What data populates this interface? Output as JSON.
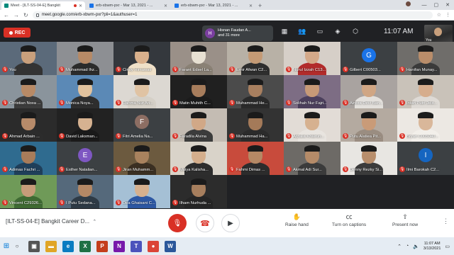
{
  "browser": {
    "tabs": [
      {
        "label": "Meet - [ILT-SS-04-E] Bangkit",
        "active": true,
        "recording": true
      },
      {
        "label": "erb-xbwm-pxr - Mar 13, 2021 - ...",
        "active": false,
        "recording": false
      },
      {
        "label": "erb-xbwm-pxr - Mar 13, 2021 - ...",
        "active": false,
        "recording": false
      }
    ],
    "url": "meet.google.com/erb-xbwm-pxr?pli=1&authuser=1"
  },
  "meet": {
    "recording_label": "REC",
    "presenter_initial": "H",
    "presenter_line1": "Hisnan Faudan A...",
    "presenter_line2": "and 31 more",
    "time": "11:07 AM",
    "self_label": "You",
    "meeting_name": "[ILT-SS-04-E] Bangkit Career D...",
    "controls": {
      "raise_hand": "Raise hand",
      "captions": "Turn on captions",
      "present": "Present now"
    },
    "participants": [
      {
        "name": "You",
        "initial": "",
        "skin": "#c9a07c",
        "bg": "#5b6a7a",
        "shirt": "#333333"
      },
      {
        "name": "Muhammad Ihz...",
        "initial": "",
        "skin": "#b78a66",
        "bg": "#8d8f93",
        "shirt": "#2b2b2b"
      },
      {
        "name": "Cindy Himawati",
        "initial": "",
        "skin": "#d9b08c",
        "bg": "#34383d",
        "shirt": "#efe0c8"
      },
      {
        "name": "Farant Edsel La...",
        "initial": "",
        "skin": "#e7e0d2",
        "bg": "#9a9088",
        "shirt": "#8a8175"
      },
      {
        "name": "Emir Afwan C2...",
        "initial": "",
        "skin": "#c49a75",
        "bg": "#b8b1a6",
        "shirt": "#2e2e2e"
      },
      {
        "name": "Nurul Izzah C13...",
        "initial": "",
        "skin": "#d4a989",
        "bg": "#d6cfc8",
        "shirt": "#b22b2b"
      },
      {
        "name": "Gilbert C00503...",
        "initial": "G",
        "skin": "",
        "bg": "#3c4043",
        "shirt": "",
        "letter_bg": "#1a73e8"
      },
      {
        "name": "Hanifan Munay...",
        "initial": "",
        "skin": "#b98d6a",
        "bg": "#6f6d6a",
        "shirt": "#3a3a3a"
      },
      {
        "name": "Christian Noxa ...",
        "initial": "",
        "skin": "#b88a66",
        "bg": "#8a949c",
        "shirt": "#3c3c3c"
      },
      {
        "name": "Monica Noya...",
        "initial": "",
        "skin": "#e1c29d",
        "bg": "#5b89b6",
        "shirt": "#2e2e2e"
      },
      {
        "name": "Rahma Nur Ari...",
        "initial": "",
        "skin": "#e0c3a3",
        "bg": "#dcd8d2",
        "shirt": "#d5d0c7"
      },
      {
        "name": "Matin Muhith C...",
        "initial": "",
        "skin": "#a77d5c",
        "bg": "#202020",
        "shirt": "#1b1b1b"
      },
      {
        "name": "Muhammad He...",
        "initial": "",
        "skin": "#a87f5f",
        "bg": "#4b4b4b",
        "shirt": "#2a2a2a"
      },
      {
        "name": "Solihah Nur Fajri...",
        "initial": "",
        "skin": "#c79a77",
        "bg": "#7d6d84",
        "shirt": "#4b3f5c"
      },
      {
        "name": "Alnora Devi Ban...",
        "initial": "",
        "skin": "#d0a684",
        "bg": "#a9a3a0",
        "shirt": "#e3e0dc"
      },
      {
        "name": "Intan Putri Jelit...",
        "initial": "",
        "skin": "#d6ad8d",
        "bg": "#c9c2b9",
        "shirt": "#dedad5"
      },
      {
        "name": "Ahmad Arbain ...",
        "initial": "",
        "skin": "#b78b6a",
        "bg": "#2b2b2b",
        "shirt": "#2c2c2c"
      },
      {
        "name": "David Laksman...",
        "initial": "",
        "skin": "#d6b291",
        "bg": "#222222",
        "shirt": "#1a1a1a"
      },
      {
        "name": "Fitri Amelia Na...",
        "initial": "F",
        "skin": "",
        "bg": "#3c4043",
        "shirt": "",
        "letter_bg": "#8d6e63"
      },
      {
        "name": "Faradila Alvina",
        "initial": "",
        "skin": "#d1a887",
        "bg": "#c4bcb3",
        "shirt": "#3c3c3c"
      },
      {
        "name": "Muhammad Ha...",
        "initial": "",
        "skin": "#a47a59",
        "bg": "#333333",
        "shirt": "#2b2b2b"
      },
      {
        "name": "Arzalia Khairun...",
        "initial": "",
        "skin": "#d6b190",
        "bg": "#e2dcd6",
        "shirt": "#e8e4df"
      },
      {
        "name": "Putu Alatiea Pit...",
        "initial": "",
        "skin": "#c99b78",
        "bg": "#b4aaa0",
        "shirt": "#9a8d81"
      },
      {
        "name": "Bryan C005040...",
        "initial": "",
        "skin": "#d9b79a",
        "bg": "#ece8e3",
        "shirt": "#f2efea"
      },
      {
        "name": "Adimas Fachri ...",
        "initial": "",
        "skin": "#a87c5a",
        "bg": "#2f6b8f",
        "shirt": "#1f3f5a"
      },
      {
        "name": "Esther Natalian...",
        "initial": "E",
        "skin": "",
        "bg": "#3c4043",
        "shirt": "",
        "letter_bg": "#7e57c2"
      },
      {
        "name": "Jiran Muhamm...",
        "initial": "",
        "skin": "#a8825e",
        "bg": "#6c5a3f",
        "shirt": "#3a2f22"
      },
      {
        "name": "Muiya Kalisha...",
        "initial": "",
        "skin": "#d4ae8c",
        "bg": "#d9d3c9",
        "shirt": "#2d2d2d"
      },
      {
        "name": "Fahmi Dimas ...",
        "initial": "",
        "skin": "#b58965",
        "bg": "#c84b3c",
        "shirt": "#2c2c2c"
      },
      {
        "name": "Akmal Adi Sur...",
        "initial": "",
        "skin": "#b58b68",
        "bg": "#6d6a66",
        "shirt": "#3b3b3b"
      },
      {
        "name": "Denny Rezky Si...",
        "initial": "",
        "skin": "#b88e6c",
        "bg": "#e8e6e2",
        "shirt": "#3b3b3b"
      },
      {
        "name": "Ilmi Barokah C2...",
        "initial": "I",
        "skin": "",
        "bg": "#3c4043",
        "shirt": "",
        "letter_bg": "#1565c0"
      },
      {
        "name": "Vincent C29326...",
        "initial": "",
        "skin": "#c79c7a",
        "bg": "#6f9a58",
        "shirt": "#3f6a33"
      },
      {
        "name": "I Putu Sedana...",
        "initial": "",
        "skin": "#b48865",
        "bg": "#55697b",
        "shirt": "#2e3a45"
      },
      {
        "name": "Dea Ghaisani C...",
        "initial": "",
        "skin": "#d6b08e",
        "bg": "#a5c0d5",
        "shirt": "#2d57a3"
      },
      {
        "name": "Ilham Nurhuda ...",
        "initial": "",
        "skin": "#a67e5d",
        "bg": "#2c2c2c",
        "shirt": "#252525"
      }
    ]
  },
  "taskbar": {
    "apps": [
      {
        "name": "task-view",
        "glyph": "▣",
        "color": "#555555"
      },
      {
        "name": "file-explorer",
        "glyph": "▬",
        "color": "#e0a526"
      },
      {
        "name": "edge",
        "glyph": "e",
        "color": "#0a7cc1"
      },
      {
        "name": "excel",
        "glyph": "X",
        "color": "#1e7145"
      },
      {
        "name": "powerpoint",
        "glyph": "P",
        "color": "#c43e1c"
      },
      {
        "name": "onenote",
        "glyph": "N",
        "color": "#7719aa"
      },
      {
        "name": "teams",
        "glyph": "T",
        "color": "#4b53bc"
      },
      {
        "name": "chrome",
        "glyph": "●",
        "color": "#db4437"
      },
      {
        "name": "word",
        "glyph": "W",
        "color": "#2b579a"
      }
    ],
    "time": "11:07 AM",
    "date": "3/13/2021"
  }
}
